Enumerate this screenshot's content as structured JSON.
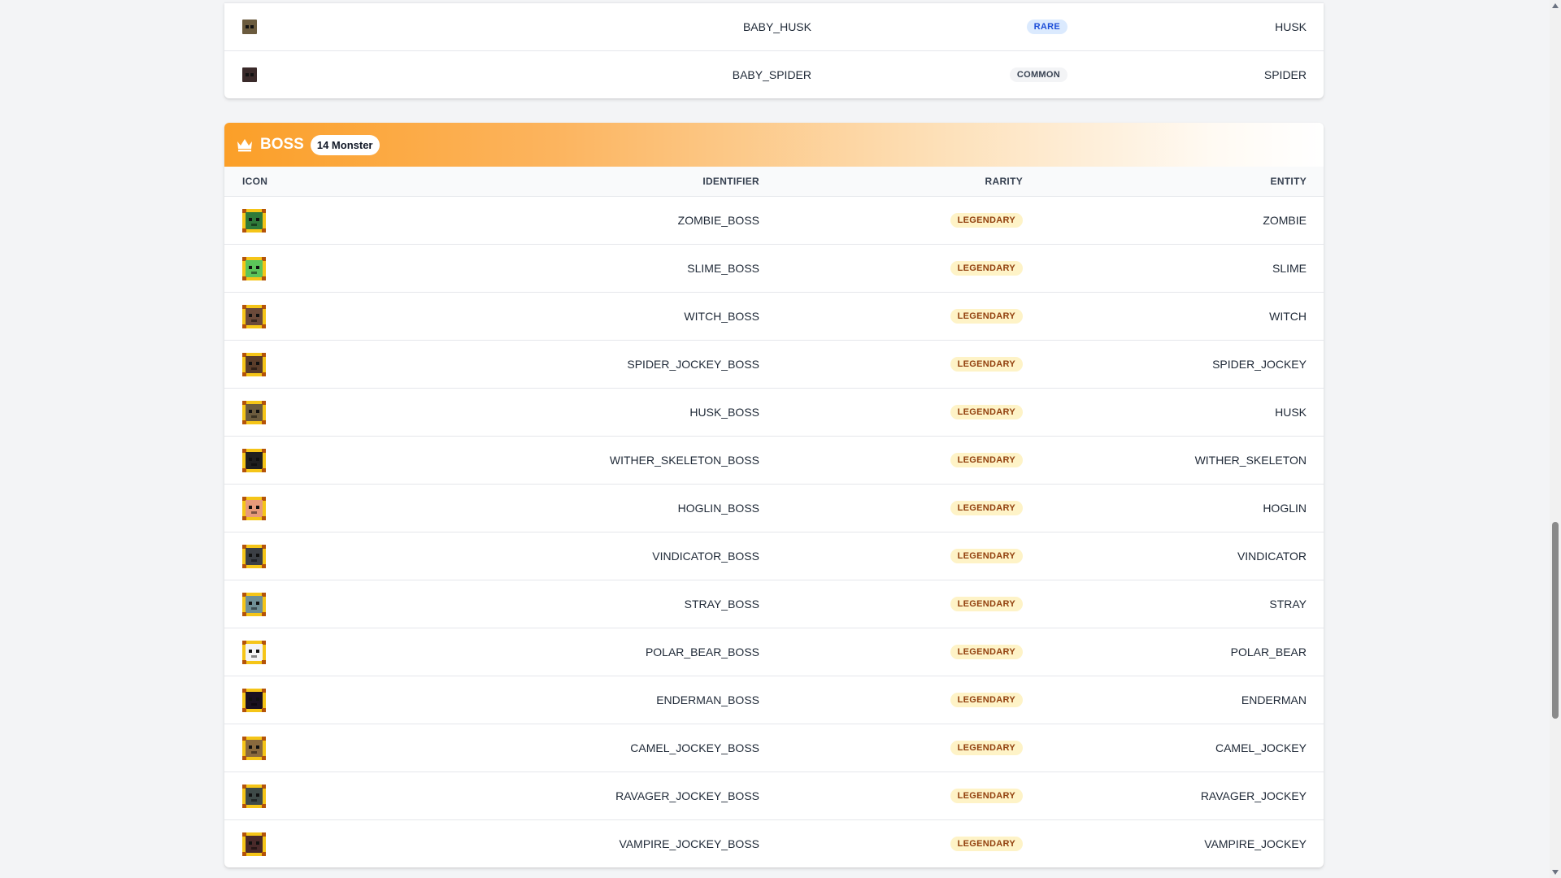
{
  "top_rows": [
    {
      "identifier": "BABY_HUSK",
      "rarity": "RARE",
      "rarity_class": "badge-rare",
      "entity": "HUSK",
      "icon": "husk-icon",
      "color": "#6b5b3e"
    },
    {
      "identifier": "BABY_SPIDER",
      "rarity": "COMMON",
      "rarity_class": "badge-common",
      "entity": "SPIDER",
      "icon": "spider-icon",
      "color": "#3a2a2a"
    }
  ],
  "boss": {
    "title": "BOSS",
    "count": "14 Monster",
    "icon": "crown-icon",
    "columns": {
      "icon": "ICON",
      "identifier": "IDENTIFIER",
      "rarity": "RARITY",
      "entity": "ENTITY"
    },
    "rows": [
      {
        "identifier": "ZOMBIE_BOSS",
        "rarity": "LEGENDARY",
        "entity": "ZOMBIE",
        "icon": "zombie-icon",
        "color": "#2f7a3a"
      },
      {
        "identifier": "SLIME_BOSS",
        "rarity": "LEGENDARY",
        "entity": "SLIME",
        "icon": "slime-icon",
        "color": "#5cc45a"
      },
      {
        "identifier": "WITCH_BOSS",
        "rarity": "LEGENDARY",
        "entity": "WITCH",
        "icon": "witch-icon",
        "color": "#6b4a3a"
      },
      {
        "identifier": "SPIDER_JOCKEY_BOSS",
        "rarity": "LEGENDARY",
        "entity": "SPIDER_JOCKEY",
        "icon": "spider-jockey-icon",
        "color": "#5a3d2a"
      },
      {
        "identifier": "HUSK_BOSS",
        "rarity": "LEGENDARY",
        "entity": "HUSK",
        "icon": "husk-icon",
        "color": "#6b5b3e"
      },
      {
        "identifier": "WITHER_SKELETON_BOSS",
        "rarity": "LEGENDARY",
        "entity": "WITHER_SKELETON",
        "icon": "wither-skeleton-icon",
        "color": "#1f1f1f"
      },
      {
        "identifier": "HOGLIN_BOSS",
        "rarity": "LEGENDARY",
        "entity": "HOGLIN",
        "icon": "hoglin-icon",
        "color": "#e79a7a"
      },
      {
        "identifier": "VINDICATOR_BOSS",
        "rarity": "LEGENDARY",
        "entity": "VINDICATOR",
        "icon": "vindicator-icon",
        "color": "#3b3f45"
      },
      {
        "identifier": "STRAY_BOSS",
        "rarity": "LEGENDARY",
        "entity": "STRAY",
        "icon": "stray-icon",
        "color": "#6f8f95"
      },
      {
        "identifier": "POLAR_BEAR_BOSS",
        "rarity": "LEGENDARY",
        "entity": "POLAR_BEAR",
        "icon": "polar-bear-icon",
        "color": "#f4f4f4"
      },
      {
        "identifier": "ENDERMAN_BOSS",
        "rarity": "LEGENDARY",
        "entity": "ENDERMAN",
        "icon": "enderman-icon",
        "color": "#1a1020"
      },
      {
        "identifier": "CAMEL_JOCKEY_BOSS",
        "rarity": "LEGENDARY",
        "entity": "CAMEL_JOCKEY",
        "icon": "camel-jockey-icon",
        "color": "#8a6a3e"
      },
      {
        "identifier": "RAVAGER_JOCKEY_BOSS",
        "rarity": "LEGENDARY",
        "entity": "RAVAGER_JOCKEY",
        "icon": "ravager-jockey-icon",
        "color": "#3e4a48"
      },
      {
        "identifier": "VAMPIRE_JOCKEY_BOSS",
        "rarity": "LEGENDARY",
        "entity": "VAMPIRE_JOCKEY",
        "icon": "vampire-jockey-icon",
        "color": "#4a2a2a"
      }
    ]
  }
}
